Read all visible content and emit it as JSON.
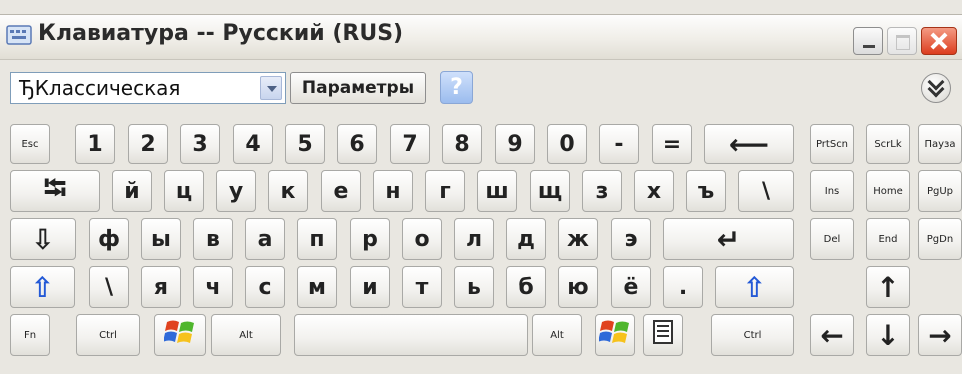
{
  "window": {
    "title": "Клавиатура -- Русский (RUS)",
    "title_icon": "keyboard-icon",
    "controls": {
      "minimize": "minimize-icon",
      "maximize": "maximize-icon",
      "close": "close-icon"
    }
  },
  "toolbar": {
    "layout_value": "ЂКлассическая",
    "parameters_label": "Параметры",
    "help_label": "?",
    "collapse_icon": "double-chevron-down-icon"
  },
  "colors": {
    "accent_blue": "#2359d6",
    "close_red": "#dc3d1e",
    "key_bg": "#f2f1ee"
  },
  "keys": [
    {
      "id": "esc",
      "label": "Esc",
      "size": "xs"
    },
    {
      "id": "1",
      "label": "1"
    },
    {
      "id": "2",
      "label": "2"
    },
    {
      "id": "3",
      "label": "3"
    },
    {
      "id": "4",
      "label": "4"
    },
    {
      "id": "5",
      "label": "5"
    },
    {
      "id": "6",
      "label": "6"
    },
    {
      "id": "7",
      "label": "7"
    },
    {
      "id": "8",
      "label": "8"
    },
    {
      "id": "9",
      "label": "9"
    },
    {
      "id": "0",
      "label": "0"
    },
    {
      "id": "minus",
      "label": "-"
    },
    {
      "id": "equals",
      "label": "="
    },
    {
      "id": "backspace",
      "label": "⟵",
      "icon": "backspace-arrow-icon"
    },
    {
      "id": "prtscn",
      "label": "PrtScn",
      "size": "xs"
    },
    {
      "id": "scrlk",
      "label": "ScrLk",
      "size": "xs"
    },
    {
      "id": "pause",
      "label": "Пауза",
      "size": "xs"
    },
    {
      "id": "tab",
      "label": "⭾",
      "icon": "tab-icon"
    },
    {
      "id": "й",
      "label": "й"
    },
    {
      "id": "ц",
      "label": "ц"
    },
    {
      "id": "у",
      "label": "у"
    },
    {
      "id": "к",
      "label": "к"
    },
    {
      "id": "е",
      "label": "е"
    },
    {
      "id": "н",
      "label": "н"
    },
    {
      "id": "г",
      "label": "г"
    },
    {
      "id": "ш",
      "label": "ш"
    },
    {
      "id": "щ",
      "label": "щ"
    },
    {
      "id": "з",
      "label": "з"
    },
    {
      "id": "х",
      "label": "х"
    },
    {
      "id": "ъ",
      "label": "ъ"
    },
    {
      "id": "backslash1",
      "label": "\\"
    },
    {
      "id": "ins",
      "label": "Ins",
      "size": "xs"
    },
    {
      "id": "home",
      "label": "Home",
      "size": "xs"
    },
    {
      "id": "pgup",
      "label": "PgUp",
      "size": "xs"
    },
    {
      "id": "capslock",
      "label": "⇩",
      "icon": "caps-lock-icon"
    },
    {
      "id": "ф",
      "label": "ф"
    },
    {
      "id": "ы",
      "label": "ы"
    },
    {
      "id": "в",
      "label": "в"
    },
    {
      "id": "а",
      "label": "а"
    },
    {
      "id": "п",
      "label": "п"
    },
    {
      "id": "р",
      "label": "р"
    },
    {
      "id": "о",
      "label": "о"
    },
    {
      "id": "л",
      "label": "л"
    },
    {
      "id": "д",
      "label": "д"
    },
    {
      "id": "ж",
      "label": "ж"
    },
    {
      "id": "э",
      "label": "э"
    },
    {
      "id": "enter",
      "label": "↵",
      "icon": "enter-icon"
    },
    {
      "id": "del",
      "label": "Del",
      "size": "xs"
    },
    {
      "id": "end",
      "label": "End",
      "size": "xs"
    },
    {
      "id": "pgdn",
      "label": "PgDn",
      "size": "xs"
    },
    {
      "id": "lshift",
      "label": "⇧",
      "icon": "shift-icon",
      "color": "blue"
    },
    {
      "id": "backslash2",
      "label": "\\"
    },
    {
      "id": "я",
      "label": "я"
    },
    {
      "id": "ч",
      "label": "ч"
    },
    {
      "id": "с",
      "label": "с"
    },
    {
      "id": "м",
      "label": "м"
    },
    {
      "id": "и",
      "label": "и"
    },
    {
      "id": "т",
      "label": "т"
    },
    {
      "id": "ь",
      "label": "ь"
    },
    {
      "id": "б",
      "label": "б"
    },
    {
      "id": "ю",
      "label": "ю"
    },
    {
      "id": "ё",
      "label": "ё"
    },
    {
      "id": "period",
      "label": "."
    },
    {
      "id": "rshift",
      "label": "⇧",
      "icon": "shift-icon",
      "color": "blue"
    },
    {
      "id": "up",
      "label": "↑",
      "icon": "arrow-up-icon"
    },
    {
      "id": "fn",
      "label": "Fn",
      "size": "xs"
    },
    {
      "id": "lctrl",
      "label": "Ctrl",
      "size": "xs"
    },
    {
      "id": "lwin",
      "label": "",
      "icon": "windows-logo-icon"
    },
    {
      "id": "lalt",
      "label": "Alt",
      "size": "xs"
    },
    {
      "id": "space",
      "label": ""
    },
    {
      "id": "ralt",
      "label": "Alt",
      "size": "xs"
    },
    {
      "id": "rwin",
      "label": "",
      "icon": "windows-logo-icon"
    },
    {
      "id": "menu",
      "label": "",
      "icon": "menu-icon"
    },
    {
      "id": "rctrl",
      "label": "Ctrl",
      "size": "xs"
    },
    {
      "id": "left",
      "label": "←",
      "icon": "arrow-left-icon"
    },
    {
      "id": "down",
      "label": "↓",
      "icon": "arrow-down-icon"
    },
    {
      "id": "right",
      "label": "→",
      "icon": "arrow-right-icon"
    }
  ]
}
